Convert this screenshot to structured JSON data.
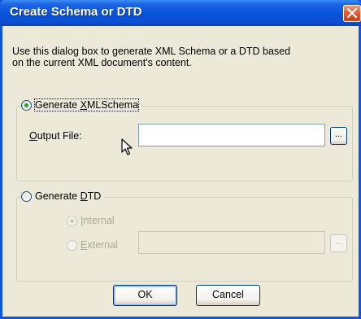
{
  "window": {
    "title": "Create Schema or DTD"
  },
  "intro": {
    "line1": "Use this dialog box to generate XML Schema or a DTD based",
    "line2": "on the current XML document's content."
  },
  "schema_group": {
    "radio_label_pre": "Generate ",
    "radio_label_u": "X",
    "radio_label_post": "MLSchema",
    "selected": true,
    "output_label_u": "O",
    "output_label_post": "utput File:",
    "output_value": "",
    "browse_label": "..."
  },
  "dtd_group": {
    "radio_label_pre": "Generate ",
    "radio_label_u": "D",
    "radio_label_post": "TD",
    "selected": false,
    "internal_label_u": "I",
    "internal_label_post": "nternal",
    "external_label_u": "E",
    "external_label_post": "xternal",
    "external_value": "",
    "browse_label": "..."
  },
  "buttons": {
    "ok": "OK",
    "cancel": "Cancel"
  },
  "colors": {
    "titlebar": "#0752d8",
    "face": "#ece9d8",
    "close": "#e45a31",
    "radio_dot": "#21a121"
  },
  "icons": {
    "close": "close-icon",
    "cursor": "mouse-cursor-icon"
  }
}
